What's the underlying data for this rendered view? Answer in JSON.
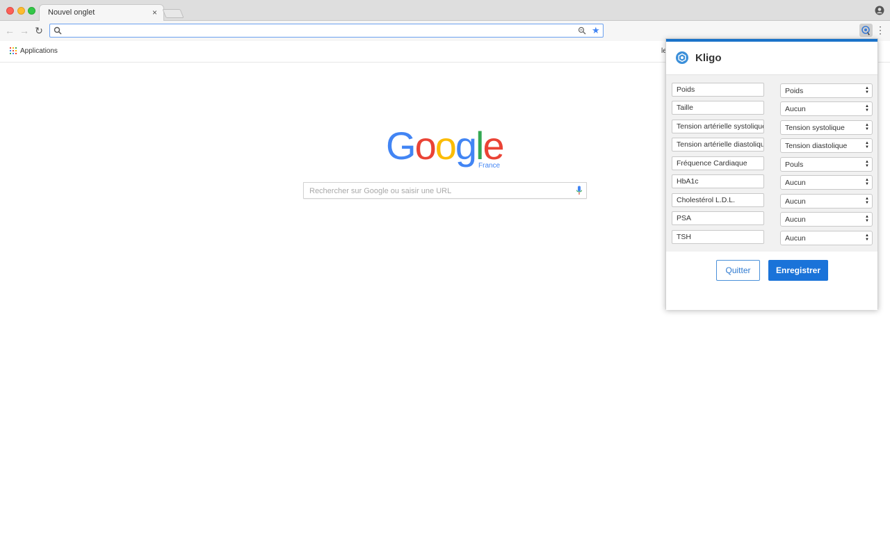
{
  "colors": {
    "accent": "#1a73d9",
    "popup_topbar": "#1a73c9",
    "google_blue": "#4285f4",
    "google_red": "#ea4335",
    "google_yellow": "#fbbc05",
    "google_green": "#34a853"
  },
  "browser": {
    "tab_title": "Nouvel onglet",
    "tab_close": "×",
    "omnibox_value": "",
    "icons": [
      "back-arrow-icon",
      "forward-arrow-icon",
      "reload-icon",
      "search-icon",
      "zoom-icon",
      "star-icon",
      "extension-icon",
      "menu-icon",
      "profile-icon"
    ]
  },
  "bookmarks": {
    "apps_label": "Applications",
    "right_fragment": "le"
  },
  "google": {
    "logo_letters": [
      "G",
      "o",
      "o",
      "g",
      "l",
      "e"
    ],
    "country": "France",
    "search_placeholder": "Rechercher sur Google ou saisir une URL"
  },
  "popup": {
    "title": "Kligo",
    "rows": [
      {
        "field": "Poids",
        "select": "Poids"
      },
      {
        "field": "Taille",
        "select": "Aucun"
      },
      {
        "field": "Tension artérielle systolique",
        "select": "Tension systolique"
      },
      {
        "field": "Tension artérielle diastolique",
        "select": "Tension diastolique"
      },
      {
        "field": "Fréquence Cardiaque",
        "select": "Pouls"
      },
      {
        "field": "HbA1c",
        "select": "Aucun"
      },
      {
        "field": "Cholestérol L.D.L.",
        "select": "Aucun"
      },
      {
        "field": "PSA",
        "select": "Aucun"
      },
      {
        "field": "TSH",
        "select": "Aucun"
      }
    ],
    "quit_label": "Quitter",
    "save_label": "Enregistrer"
  }
}
